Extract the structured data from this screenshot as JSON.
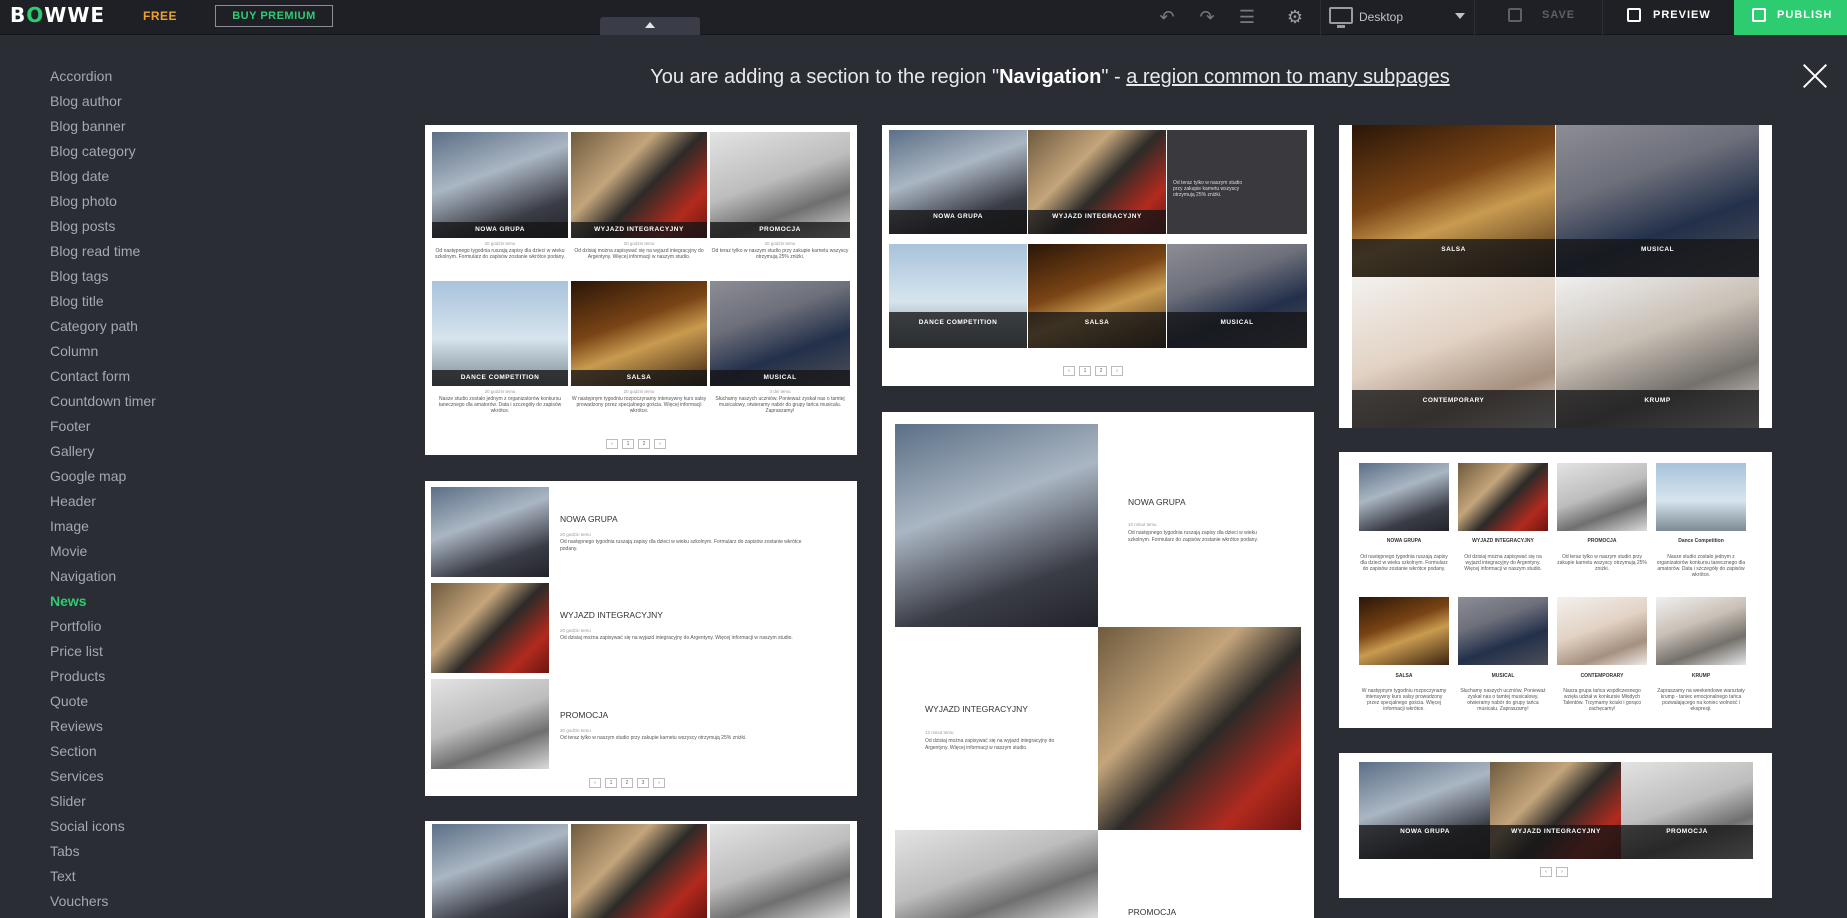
{
  "topbar": {
    "logo_pre": "B",
    "logo_o": "O",
    "logo_post": "WWE",
    "plan": "FREE",
    "buy_premium": "BUY PREMIUM",
    "device": "Desktop",
    "save": "SAVE",
    "preview": "PREVIEW",
    "publish": "PUBLISH"
  },
  "sidebar": {
    "items": [
      "Accordion",
      "Blog author",
      "Blog banner",
      "Blog category",
      "Blog date",
      "Blog photo",
      "Blog posts",
      "Blog read time",
      "Blog tags",
      "Blog title",
      "Category path",
      "Column",
      "Contact form",
      "Countdown timer",
      "Footer",
      "Gallery",
      "Google map",
      "Header",
      "Image",
      "Movie",
      "Navigation",
      "News",
      "Portfolio",
      "Price list",
      "Products",
      "Quote",
      "Reviews",
      "Section",
      "Services",
      "Slider",
      "Social icons",
      "Tabs",
      "Text",
      "Vouchers"
    ],
    "active": "News"
  },
  "banner": {
    "prefix": "You are adding a section to the region \"",
    "region": "Navigation",
    "suffix": "\" - ",
    "link": "a region common to many subpages"
  },
  "news": {
    "titles": [
      "NOWA GRUPA",
      "WYJAZD INTEGRACYJNY",
      "PROMOCJA",
      "DANCE COMPETITION",
      "SALSA",
      "MUSICAL",
      "CONTEMPORARY",
      "KRUMP"
    ],
    "title_mixed": [
      "NOWA GRUPA",
      "WYJAZD INTEGRACYJNY",
      "PROMOCJA",
      "Dance Competition",
      "SALSA",
      "MUSICAL",
      "CONTEMPORARY",
      "KRUMP"
    ],
    "times": {
      "a": "20 godzin temu",
      "b": "10 minut temu",
      "c": "7 minut temu",
      "d": "28 minut temu",
      "e": "25 minut temu",
      "f": "3 dni temu",
      "g": "34 minut temu",
      "h": "2 dni temu",
      "i": "21 godzin temu",
      "j": "12 minut temu",
      "k": "14 minut temu"
    },
    "excerpts": {
      "nowa": "Od następnego tygodnia ruszają zapisy dla dzieci w wieku szkolnym. Formularz do zapisów zostanie wkrótce podany.",
      "wyjazd": "Od dzisiaj można zapisywać się na wyjazd integracyjny do Argentyny. Więcej informacji w naszym studio.",
      "promocja": "Od teraz tylko w naszym studio przy zakupie karnetu wszyscy otrzymują 25% zniżki.",
      "dance": "Nasze studio zostało jednym z organizatorów konkursu tanecznego dla amatorów. Data i szczegóły do zapisów wkrótce.",
      "salsa": "W następnym tygodniu rozpoczynamy intensywny kurs salsy prowadzony przez specjalnego gościa. Więcej informacji wkrótce.",
      "musical": "Słuchamy naszych uczniów. Ponieważ zyskał nas o tamtej musicalowy, otwieramy nabór do grupy tańca musicalu. Zapraszamy!",
      "contemporary": "Nasza grupa tańca współczesnego wzięła udział w konkursie Młodych Talentów. Trzymamy kciuki i gorąco zachęcamy!",
      "krump": "Zapraszamy na weekendowe warsztaty krump - taniec emocjonalnego tańca pozwalającego na koniec wolność i ekspresji."
    },
    "pager": [
      "‹",
      "1",
      "2",
      "›"
    ],
    "pager3": [
      "‹",
      "1",
      "2",
      "3",
      "›"
    ],
    "pager_arrows": [
      "‹",
      "›"
    ]
  }
}
